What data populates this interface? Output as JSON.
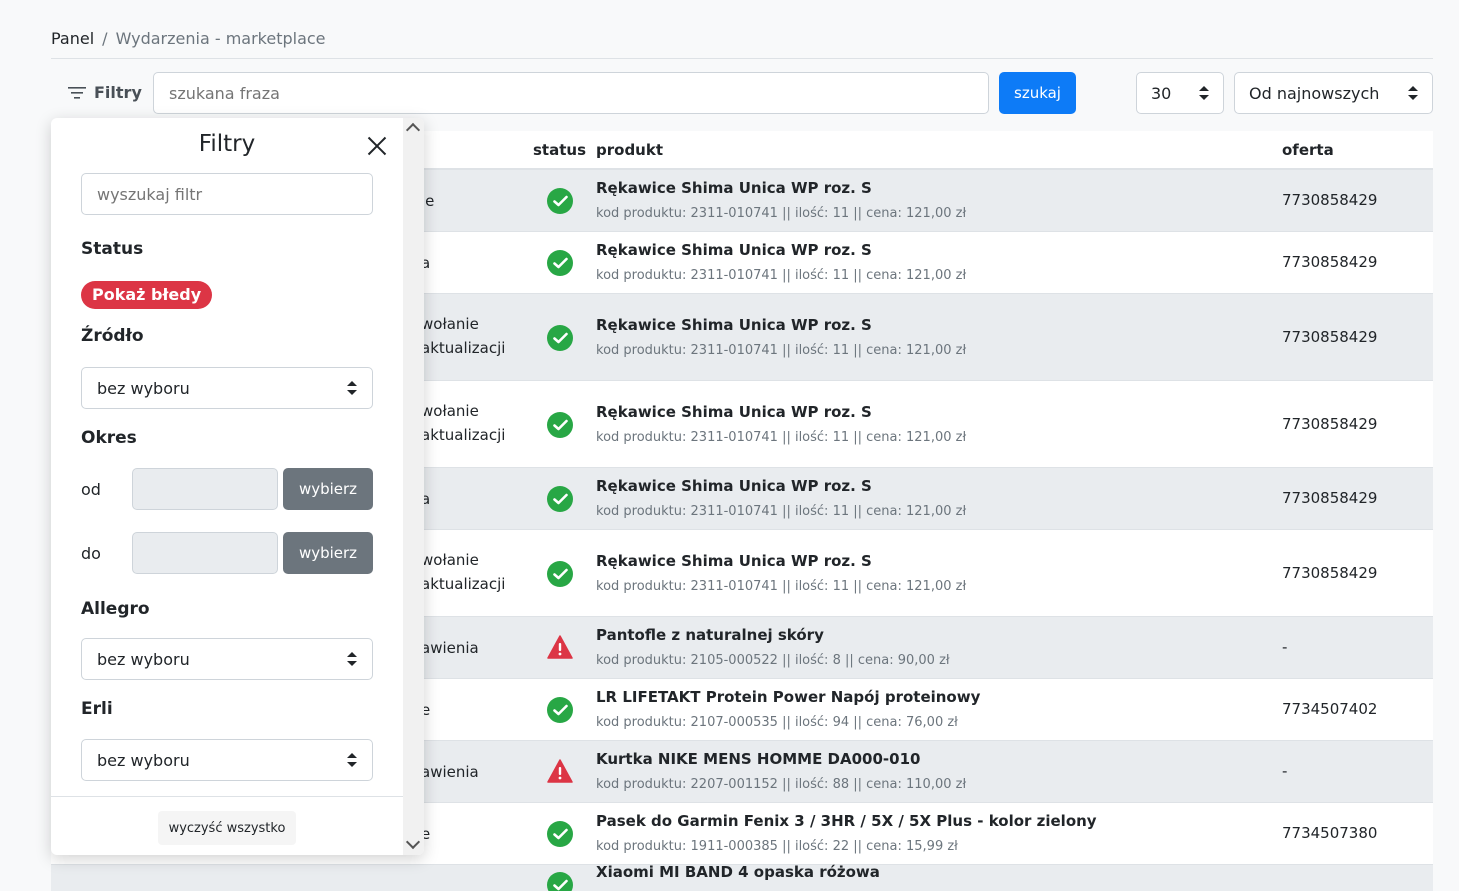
{
  "breadcrumb": {
    "root": "Panel",
    "separator": "/",
    "current": "Wydarzenia - marketplace"
  },
  "toolbar": {
    "filters_label": "Filtry",
    "search_placeholder": "szukana fraza",
    "search_button": "szukaj",
    "per_page": "30",
    "sort": "Od najnowszych"
  },
  "table": {
    "headers": {
      "status": "status",
      "product": "produkt",
      "offer": "oferta"
    },
    "rows": [
      {
        "left1": "ie",
        "left2": "",
        "status": "ok",
        "name": "Rękawice Shima Unica WP roz. S",
        "meta": "kod produktu: 2311-010741 || ilość: 11 || cena: 121,00 zł",
        "offer": "7730858429"
      },
      {
        "left1": "a",
        "left2": "",
        "status": "ok",
        "name": "Rękawice Shima Unica WP roz. S",
        "meta": "kod produktu: 2311-010741 || ilość: 11 || cena: 121,00 zł",
        "offer": "7730858429"
      },
      {
        "left1": "wołanie",
        "left2": "aktualizacji",
        "status": "ok",
        "name": "Rękawice Shima Unica WP roz. S",
        "meta": "kod produktu: 2311-010741 || ilość: 11 || cena: 121,00 zł",
        "offer": "7730858429"
      },
      {
        "left1": "wołanie",
        "left2": "aktualizacji",
        "status": "ok",
        "name": "Rękawice Shima Unica WP roz. S",
        "meta": "kod produktu: 2311-010741 || ilość: 11 || cena: 121,00 zł",
        "offer": "7730858429"
      },
      {
        "left1": "a",
        "left2": "",
        "status": "ok",
        "name": "Rękawice Shima Unica WP roz. S",
        "meta": "kod produktu: 2311-010741 || ilość: 11 || cena: 121,00 zł",
        "offer": "7730858429"
      },
      {
        "left1": "wołanie",
        "left2": "aktualizacji",
        "status": "ok",
        "name": "Rękawice Shima Unica WP roz. S",
        "meta": "kod produktu: 2311-010741 || ilość: 11 || cena: 121,00 zł",
        "offer": "7730858429"
      },
      {
        "left1": "awienia",
        "left2": "",
        "status": "error",
        "name": "Pantofle z naturalnej skóry",
        "meta": "kod produktu: 2105-000522 || ilość: 8 || cena: 90,00 zł",
        "offer": "-"
      },
      {
        "left1": "e",
        "left2": "",
        "status": "ok",
        "name": "LR LIFETAKT Protein Power Napój proteinowy",
        "meta": "kod produktu: 2107-000535 || ilość: 94 || cena: 76,00 zł",
        "offer": "7734507402"
      },
      {
        "left1": "awienia",
        "left2": "",
        "status": "error",
        "name": "Kurtka NIKE MENS HOMME DA000-010",
        "meta": "kod produktu: 2207-001152 || ilość: 88 || cena: 110,00 zł",
        "offer": "-"
      },
      {
        "left1": "e",
        "left2": "",
        "status": "ok",
        "name": "Pasek do Garmin Fenix 3 / 3HR / 5X / 5X Plus - kolor zielony",
        "meta": "kod produktu: 1911-000385 || ilość: 22 || cena: 15,99 zł",
        "offer": "7734507380"
      },
      {
        "left1": "",
        "left2": "",
        "status": "ok",
        "name": "Xiaomi MI BAND 4 opaska różowa",
        "meta": "",
        "offer": ""
      }
    ]
  },
  "filters": {
    "title": "Filtry",
    "search_placeholder": "wyszukaj filtr",
    "status_heading": "Status",
    "show_errors": "Pokaż błedy",
    "source_heading": "Źródło",
    "source_value": "bez wyboru",
    "period_heading": "Okres",
    "from_label": "od",
    "to_label": "do",
    "choose_button": "wybierz",
    "allegro_heading": "Allegro",
    "allegro_value": "bez wyboru",
    "erli_heading": "Erli",
    "erli_value": "bez wyboru",
    "clear_all": "wyczyść wszystko"
  }
}
